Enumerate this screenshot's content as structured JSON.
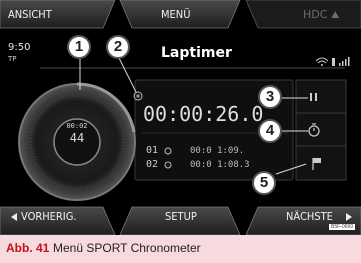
{
  "softkeys": {
    "top_left": "ANSICHT",
    "top_center": "MENÜ",
    "top_right": "HDC",
    "bottom_left": "VORHERIG.",
    "bottom_center": "SETUP",
    "bottom_right": "NÄCHSTE"
  },
  "status": {
    "time": "9:50",
    "mode": "TP"
  },
  "title": "Laptimer",
  "main_time": "00:00:26.0",
  "dial": {
    "small_top": "00:02",
    "small_bottom": "44"
  },
  "laps": [
    {
      "number": "01",
      "time": "00:0 1:09."
    },
    {
      "number": "02",
      "time": "00:0 1:08.3"
    }
  ],
  "callouts": [
    "1",
    "2",
    "3",
    "4",
    "5"
  ],
  "image_ref": "B5F-0699",
  "caption": {
    "label": "Abb. 41",
    "text": "Menü SPORT Chronometer"
  },
  "colors": {
    "caption_bg": "#f7dadd",
    "caption_label": "#c5121b",
    "screen_bg": "#000000"
  },
  "icons": [
    "pause-icon",
    "stopwatch-icon",
    "flag-icon",
    "wifi-icon",
    "signal-icon",
    "plus-icon",
    "left-triangle-icon",
    "right-triangle-icon"
  ]
}
